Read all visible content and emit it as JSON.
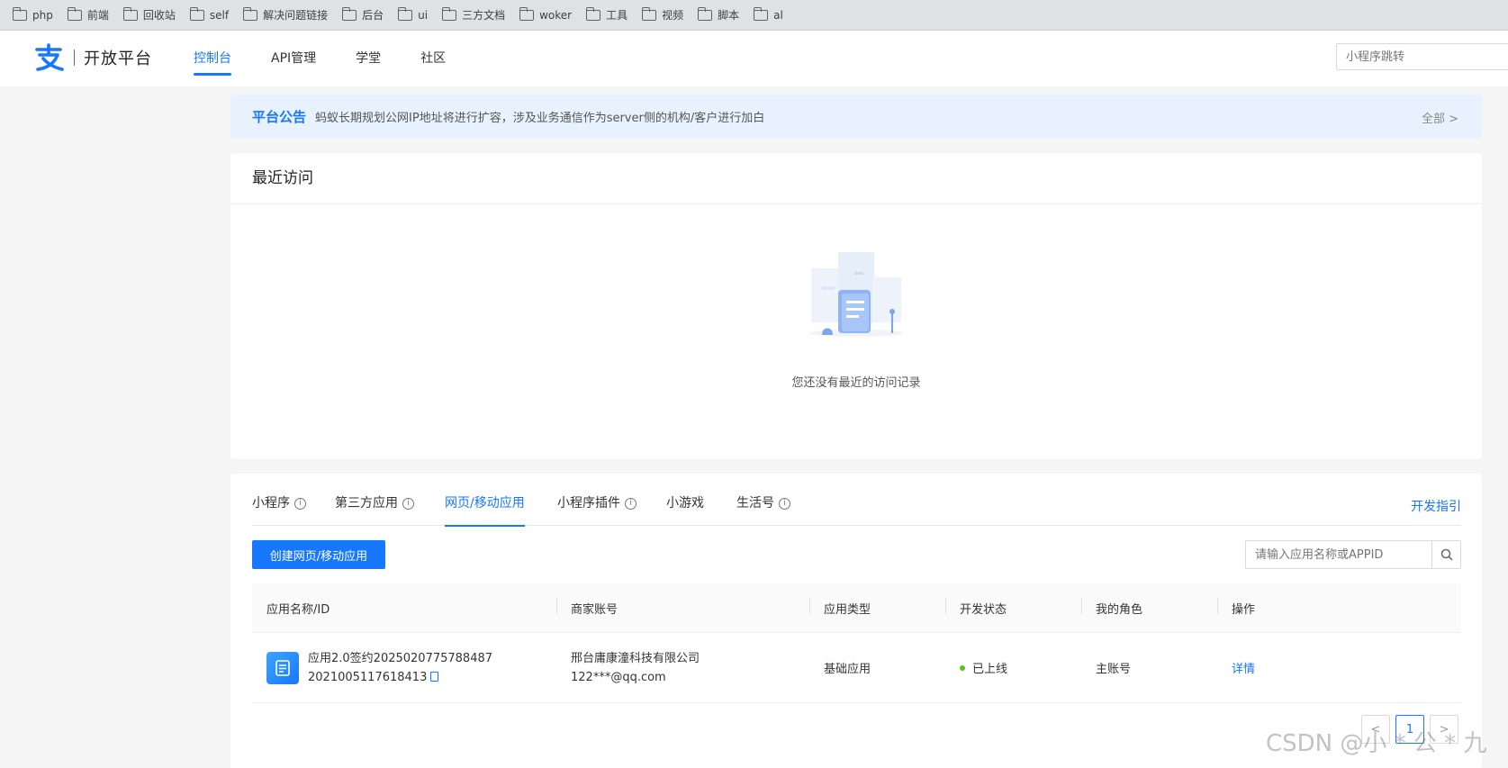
{
  "bookmarks": [
    "php",
    "前端",
    "回收站",
    "self",
    "解决问题链接",
    "后台",
    "ui",
    "三方文档",
    "woker",
    "工具",
    "视频",
    "脚本",
    "al"
  ],
  "brand": {
    "name": "开放平台",
    "color": "#1677ff"
  },
  "nav": {
    "tabs": [
      {
        "label": "控制台",
        "active": true
      },
      {
        "label": "API管理",
        "active": false
      },
      {
        "label": "学堂",
        "active": false
      },
      {
        "label": "社区",
        "active": false
      }
    ],
    "jump_placeholder": "小程序跳转"
  },
  "notice": {
    "title": "平台公告",
    "text": "蚂蚁长期规划公网IP地址将进行扩容，涉及业务通信作为server侧的机构/客户进行加白",
    "all_label": "全部 >"
  },
  "recent": {
    "title": "最近访问",
    "empty_text": "您还没有最近的访问记录"
  },
  "apps": {
    "tabs": [
      {
        "label": "小程序",
        "info": true,
        "active": false
      },
      {
        "label": "第三方应用",
        "info": true,
        "active": false
      },
      {
        "label": "网页/移动应用",
        "info": false,
        "active": true
      },
      {
        "label": "小程序插件",
        "info": true,
        "active": false
      },
      {
        "label": "小游戏",
        "info": false,
        "active": false
      },
      {
        "label": "生活号",
        "info": true,
        "active": false
      }
    ],
    "dev_guide": "开发指引",
    "create_button": "创建网页/移动应用",
    "search_placeholder": "请输入应用名称或APPID",
    "columns": [
      "应用名称/ID",
      "商家账号",
      "应用类型",
      "开发状态",
      "我的角色",
      "操作"
    ],
    "rows": [
      {
        "name": "应用2.0签约2025020775788487",
        "id": "2021005117618413",
        "merchant_name": "邢台庸康潼科技有限公司",
        "merchant_email": "122***@qq.com",
        "type": "基础应用",
        "status": "已上线",
        "role": "主账号",
        "action": "详情"
      }
    ],
    "pagination": {
      "prev": "<",
      "current": "1",
      "next": ">"
    }
  },
  "watermark": "CSDN @小 * 公 * 九"
}
